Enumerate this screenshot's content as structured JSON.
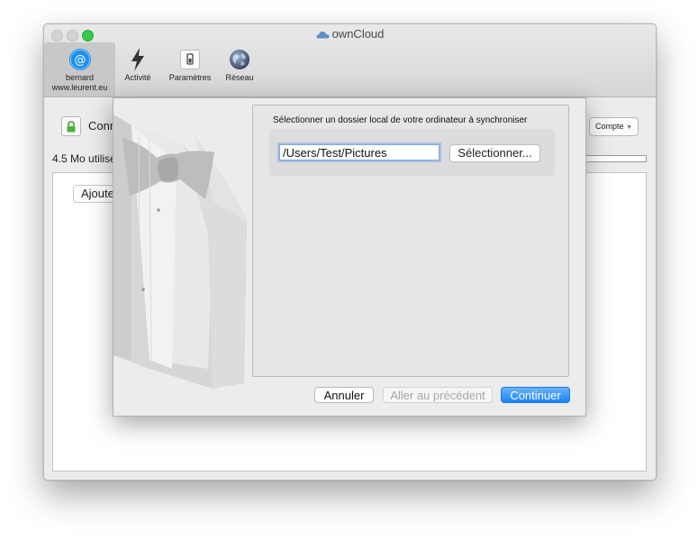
{
  "window": {
    "title": "ownCloud"
  },
  "toolbar": {
    "tabs": [
      {
        "label_line1": "bernard",
        "label_line2": "www.leurent.eu",
        "icon": "at-icon",
        "selected": true
      },
      {
        "label": "Activité",
        "icon": "lightning-icon"
      },
      {
        "label": "Paramètres",
        "icon": "switch-icon"
      },
      {
        "label": "Réseau",
        "icon": "globe-icon"
      }
    ]
  },
  "account": {
    "connection_text": "Conn",
    "compte_button": "Compte",
    "usage_text": "4.5 Mo utilisé",
    "add_button": "Ajoute"
  },
  "dialog": {
    "group_title": "Sélectionner un dossier local de votre ordinateur à synchroniser",
    "path_value": "/Users/Test/Pictures",
    "select_button": "Sélectionner...",
    "cancel_button": "Annuler",
    "previous_button": "Aller au précédent",
    "continue_button": "Continuer"
  },
  "colors": {
    "accent": "#1a82fb",
    "selected_tab": "#c8c8c8",
    "traffic_green": "#34c84a"
  }
}
